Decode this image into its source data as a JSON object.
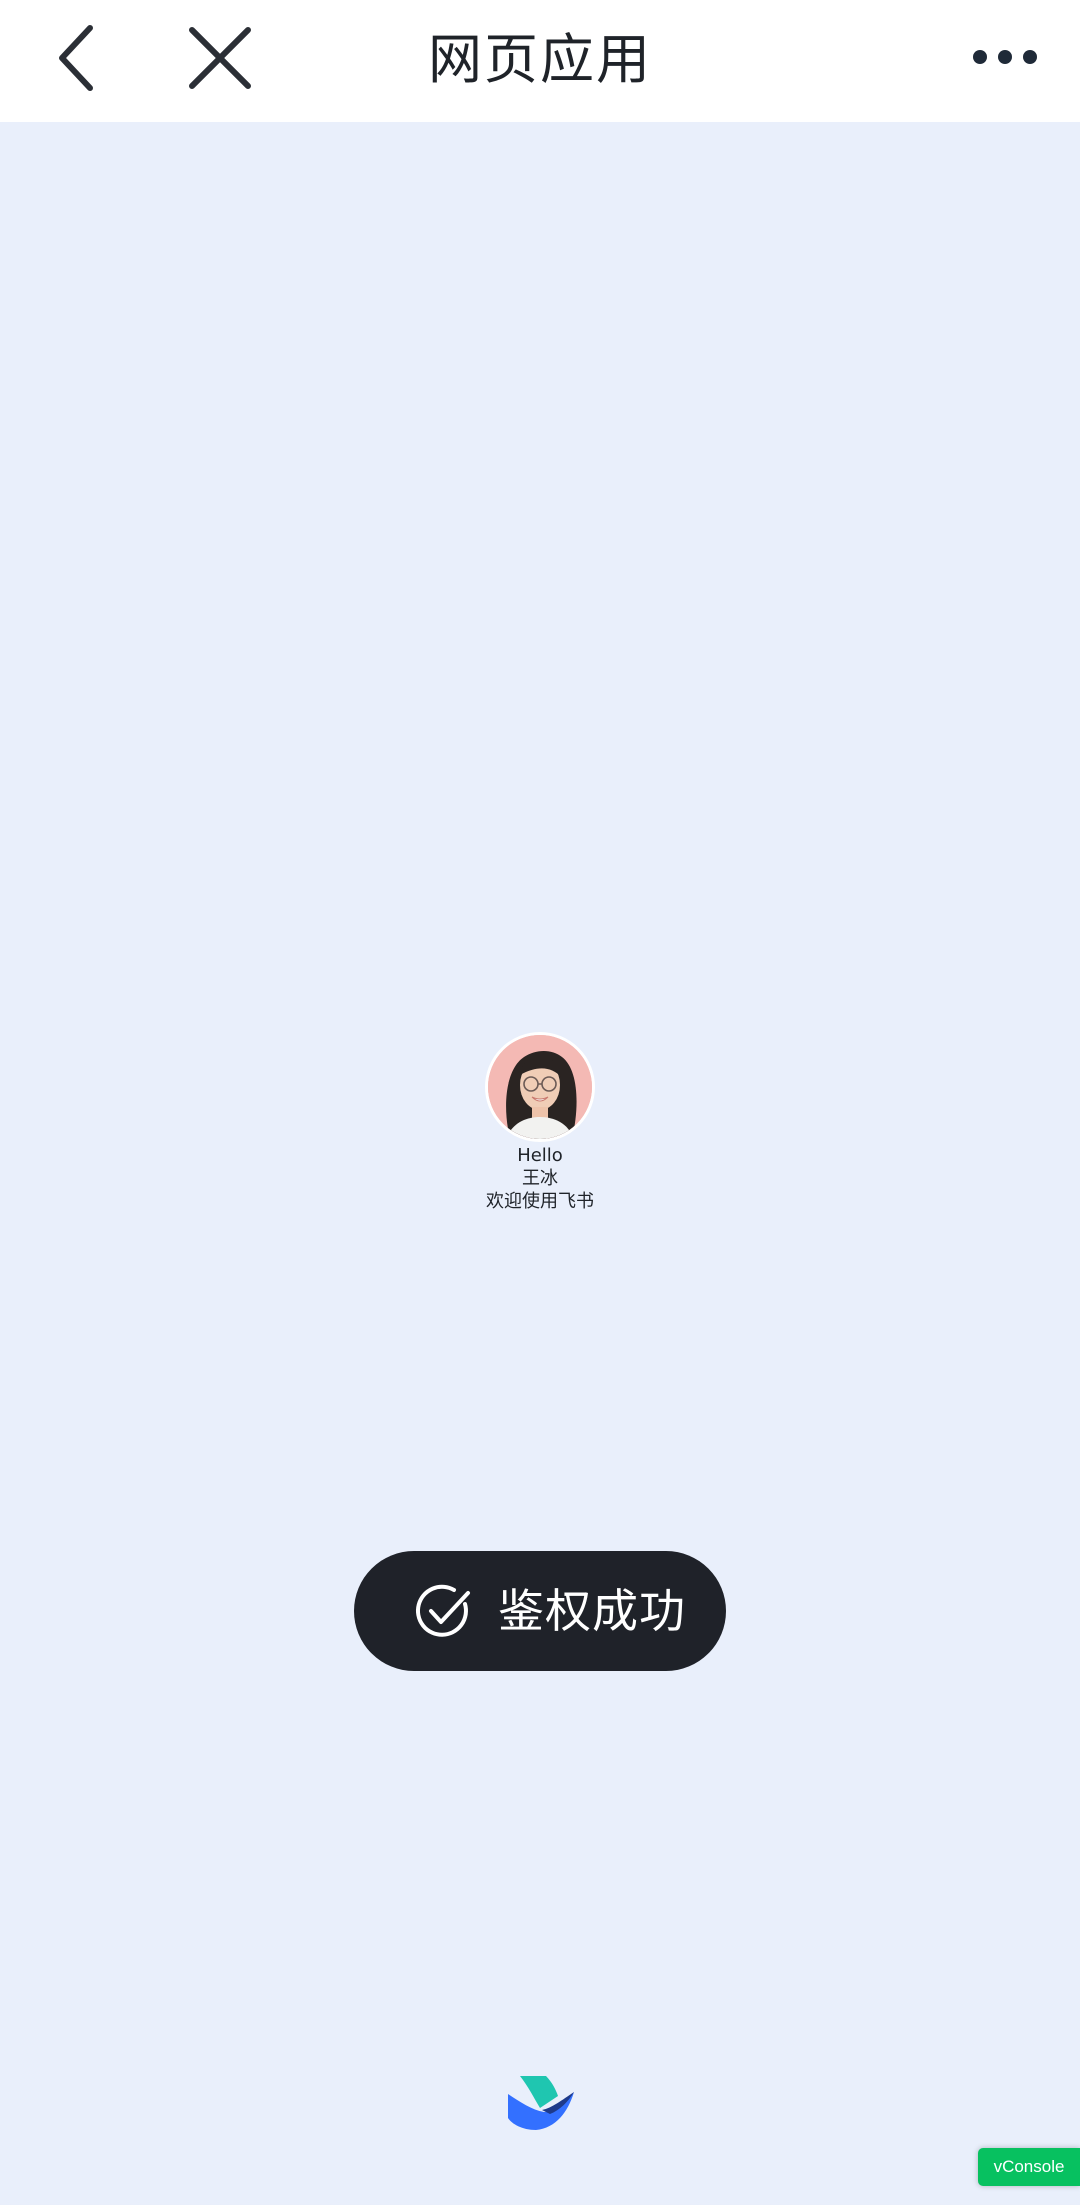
{
  "navbar": {
    "title": "网页应用",
    "back_icon": "chevron-left-icon",
    "close_icon": "close-icon",
    "more_icon": "more-dots-icon"
  },
  "user_card": {
    "greeting": "Hello",
    "user_name": "王冰",
    "welcome": "欢迎使用飞书"
  },
  "toast": {
    "message": "鉴权成功",
    "icon": "check-circle-icon"
  },
  "footer": {
    "logo": "feishu-logo"
  },
  "vconsole": {
    "label": "vConsole"
  },
  "colors": {
    "background": "#e9effb",
    "navbar": "#ffffff",
    "toast": "#1f2229",
    "vconsole": "#07c160"
  }
}
